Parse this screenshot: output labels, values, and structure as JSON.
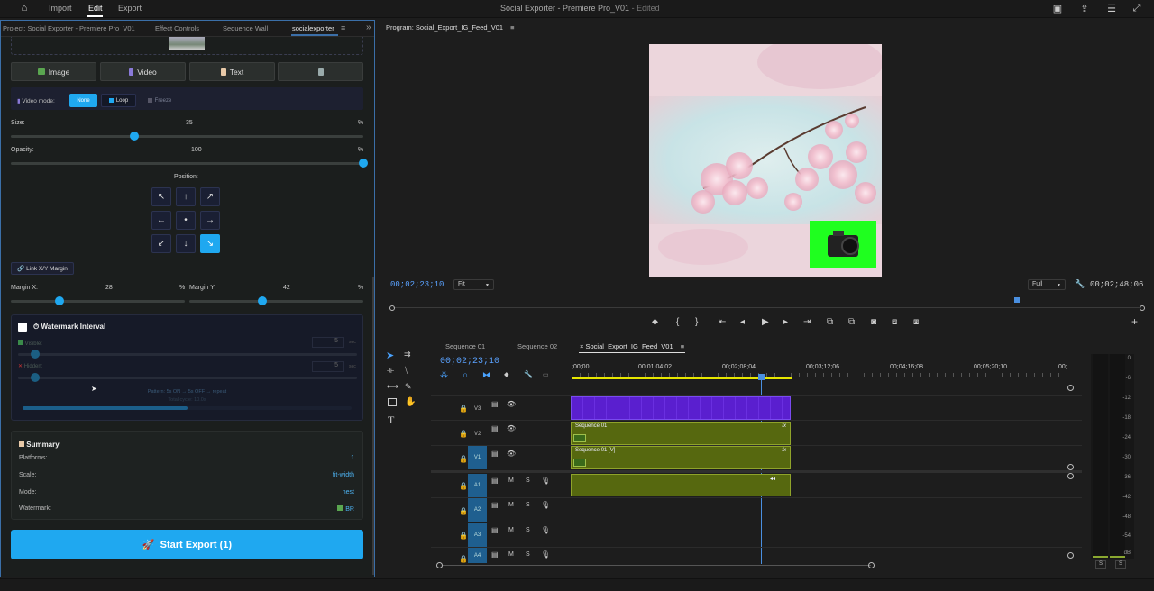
{
  "app": {
    "title": "Social Exporter - Premiere Pro_V01",
    "edited": "- Edited",
    "menu": [
      "Import",
      "Edit",
      "Export"
    ]
  },
  "left_panel": {
    "tabs": [
      "Project: Social Exporter - Premiere Pro_V01",
      "Effect Controls",
      "Sequence Wall",
      "socialexporter"
    ],
    "media_buttons": {
      "image": "Image",
      "video": "Video",
      "text": "Text"
    },
    "video_mode": {
      "label": "Video mode:",
      "options": [
        "None",
        "Loop",
        "Freeze"
      ],
      "selected": "None"
    },
    "size": {
      "label": "Size:",
      "value": "35",
      "unit": "%",
      "level": 0.35
    },
    "opacity": {
      "label": "Opacity:",
      "value": "100",
      "unit": "%",
      "level": 1.0
    },
    "position": {
      "label": "Position:",
      "arrows": [
        "↖",
        "↑",
        "↗",
        "←",
        "•",
        "→",
        "↙",
        "↓",
        "↘"
      ],
      "selected_index": 8
    },
    "link_margin": "Link X/Y Margin",
    "margin_x": {
      "label": "Margin X:",
      "value": "28",
      "unit": "%",
      "level": 0.28
    },
    "margin_y": {
      "label": "Margin Y:",
      "value": "42",
      "unit": "%",
      "level": 0.42
    },
    "watermark_interval": {
      "title": "Watermark Interval",
      "visible_label": "Visible:",
      "visible_value": "5",
      "hidden_label": "Hidden:",
      "hidden_value": "5",
      "unit": "sec",
      "pattern": "Pattern: 5s ON → 5s OFF → repeat",
      "cycle": "Total cycle: 10.0s",
      "visible_level": 0.05,
      "hidden_level": 0.05,
      "progress_level": 0.5
    },
    "summary": {
      "title": "Summary",
      "rows": [
        {
          "label": "Platforms:",
          "value": "1"
        },
        {
          "label": "Scale:",
          "value": "fit-width"
        },
        {
          "label": "Mode:",
          "value": "nest"
        },
        {
          "label": "Watermark:",
          "value": "BR"
        }
      ]
    },
    "export_button": "Start Export (1)"
  },
  "program_monitor": {
    "title": "Program: Social_Export_IG_Feed_V01",
    "current_tc": "00;02;23;10",
    "fit": "Fit",
    "quality": "Full",
    "duration_tc": "00;02;48;06",
    "playhead_level": 0.83
  },
  "timeline": {
    "tabs": [
      "Sequence 01",
      "Sequence 02",
      "Social_Export_IG_Feed_V01"
    ],
    "current_tc": "00;02;23;10",
    "ruler": [
      ";00;00",
      "00;01;04;02",
      "00;02;08;04",
      "00;03;12;06",
      "00;04;16;08",
      "00;05;20;10",
      "00;"
    ],
    "video_tracks": [
      "V3",
      "V2",
      "V1"
    ],
    "audio_tracks": [
      "A1",
      "A2",
      "A3",
      "A4"
    ],
    "track_buttons": {
      "mute": "M",
      "solo": "S"
    },
    "clips": {
      "v2": "Sequence 01",
      "v1": "Sequence 01 [V]",
      "fx": "fx"
    }
  },
  "meter": {
    "db_labels": [
      "0",
      "-6",
      "-12",
      "-18",
      "-24",
      "-30",
      "-36",
      "-42",
      "-48",
      "-54",
      "dB"
    ],
    "solo_labels": [
      "S",
      "S"
    ]
  },
  "colors": {
    "accent": "#1fa8f0",
    "clip": "#56680f",
    "v3_clip": "#5a1fcf",
    "track_label": "#1f5f8f",
    "timecode": "#5aa2ff"
  }
}
